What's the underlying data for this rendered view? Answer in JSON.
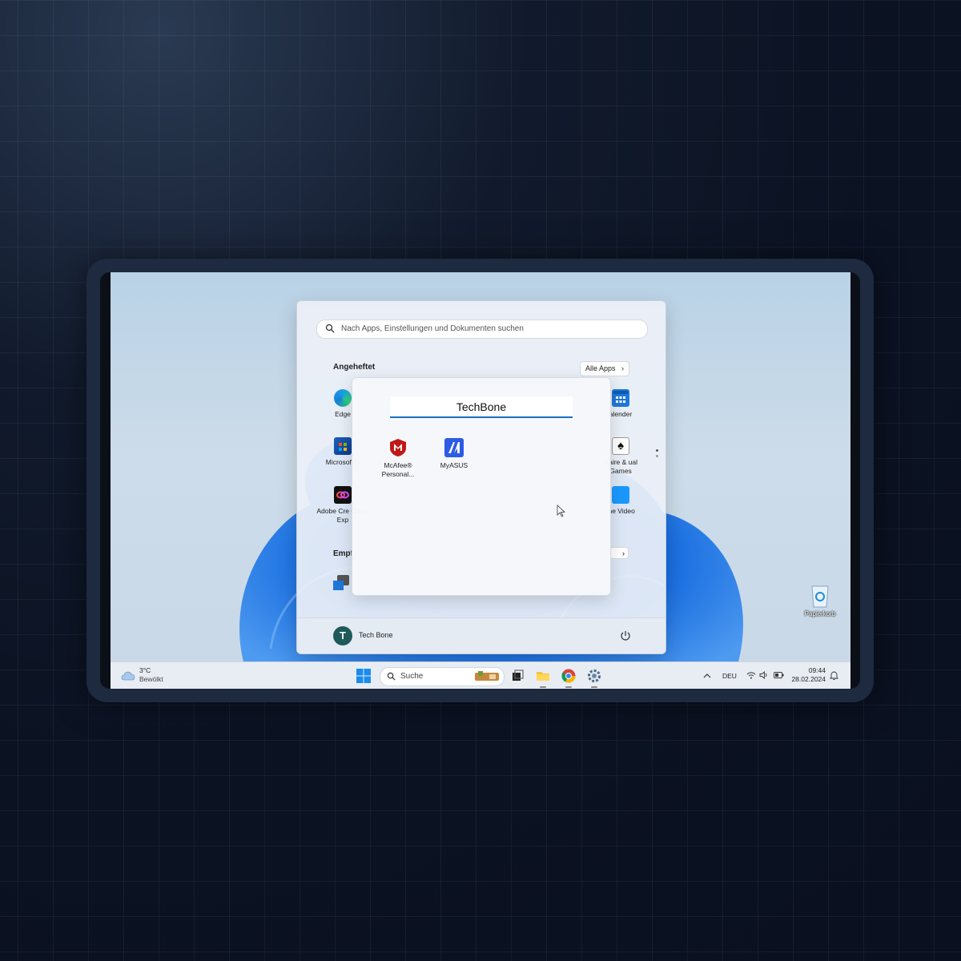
{
  "start_menu": {
    "search_placeholder": "Nach Apps, Einstellungen und Dokumenten suchen",
    "pinned_title": "Angeheftet",
    "all_apps_label": "Alle Apps",
    "pinned_apps": [
      {
        "label": "Edge",
        "icon": "edge-icon"
      },
      {
        "label": "Microsoft S",
        "icon": "microsoft-store-icon"
      },
      {
        "label": "Adobe Cre Cloud Exp",
        "icon": "adobe-creative-cloud-icon"
      },
      {
        "label": "alender",
        "icon": "calendar-icon"
      },
      {
        "label": "litaire & ual Games",
        "icon": "solitaire-icon"
      },
      {
        "label": "me Video",
        "icon": "prime-video-icon"
      }
    ],
    "recommended_title": "Empf",
    "user_name": "Tech Bone",
    "user_initial": "T"
  },
  "folder": {
    "name": "TechBone",
    "apps": [
      {
        "label_line1": "McAfee®",
        "label_line2": "Personal...",
        "icon": "mcafee-icon"
      },
      {
        "label_line1": "MyASUS",
        "label_line2": "",
        "icon": "myasus-icon"
      }
    ]
  },
  "desktop": {
    "recycle_bin_label": "Papierkorb"
  },
  "taskbar": {
    "weather_temp": "3°C",
    "weather_condition": "Bewölkt",
    "search_placeholder": "Suche",
    "language": "DEU",
    "time": "09:44",
    "date": "28.02.2024"
  },
  "colors": {
    "accent": "#1b6fc3",
    "wallpaper_bloom": "#1a6ee0"
  }
}
